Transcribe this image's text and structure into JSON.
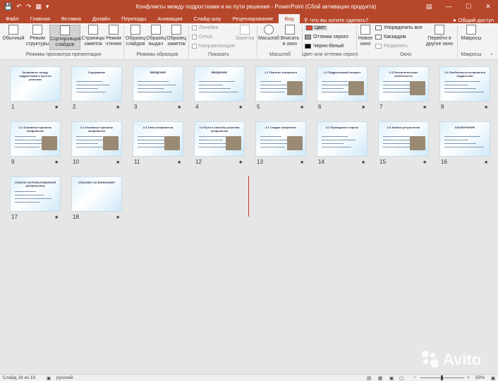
{
  "window": {
    "title": "Конфликты между подростками и их пути решения - PowerPoint (Сбой активации продукта)",
    "controls": [
      "—",
      "☐",
      "✕"
    ],
    "ribbon_display_icon": "ribbon-display-options-icon"
  },
  "quick_access": {
    "save_icon": "save-icon",
    "undo_icon": "undo-icon",
    "redo_icon": "redo-icon",
    "present_icon": "start-presentation-icon",
    "customize_icon": "customize-quick-access-icon"
  },
  "tabs": [
    "Файл",
    "Главная",
    "Вставка",
    "Дизайн",
    "Переходы",
    "Анимация",
    "Слайд-шоу",
    "Рецензирование",
    "Вид"
  ],
  "active_tab": "Вид",
  "tell_me": "Что вы хотите сделать?",
  "share": "Общий доступ",
  "ribbon": {
    "views": {
      "buttons": [
        {
          "label": "Обычный",
          "icon": "normal-view-icon"
        },
        {
          "label": "Режим структуры",
          "icon": "outline-view-icon"
        },
        {
          "label": "Сортировщик слайдов",
          "icon": "slide-sorter-icon",
          "selected": true
        },
        {
          "label": "Страницы заметок",
          "icon": "notes-page-icon"
        },
        {
          "label": "Режим чтения",
          "icon": "reading-view-icon"
        }
      ],
      "group": "Режимы просмотра презентации"
    },
    "masters": {
      "buttons": [
        {
          "label": "Образец слайдов",
          "icon": "slide-master-icon"
        },
        {
          "label": "Образец выдач",
          "icon": "handout-master-icon"
        },
        {
          "label": "Образец заметок",
          "icon": "notes-master-icon"
        }
      ],
      "group": "Режимы образцов"
    },
    "show": {
      "checks": [
        "Линейка",
        "Сетка",
        "Направляющие"
      ],
      "notes": "Заметки",
      "group": "Показать"
    },
    "zoom": {
      "buttons": [
        {
          "label": "Масштаб",
          "icon": "zoom-icon"
        },
        {
          "label": "Вписать в окно",
          "icon": "fit-to-window-icon"
        }
      ],
      "group": "Масштаб"
    },
    "color": {
      "options": [
        {
          "label": "Цвет",
          "swatch": "#e8412c"
        },
        {
          "label": "Оттенки серого",
          "swatch": "#9a9a9a"
        },
        {
          "label": "Черно-белый",
          "swatch": "#000000"
        }
      ],
      "group": "Цвет или оттенки серого"
    },
    "window": {
      "new_window": "Новое окно",
      "arrange_all": "Упорядочить все",
      "cascade": "Каскадом",
      "split": "Разделить",
      "switch": "Перейти в другое окно",
      "group": "Окно"
    },
    "macros": {
      "label": "Макросы",
      "group": "Макросы"
    }
  },
  "slides": [
    {
      "n": "1",
      "title": "Конфликты между подростками и пути их решения"
    },
    {
      "n": "2",
      "title": "Содержание"
    },
    {
      "n": "3",
      "title": "ВВЕДЕНИЕ"
    },
    {
      "n": "4",
      "title": "ВВЕДЕНИЕ"
    },
    {
      "n": "5",
      "title": "1.1 Понятие конфликта"
    },
    {
      "n": "6",
      "title": "1.2 Подростковый возраст"
    },
    {
      "n": "7",
      "title": "1.3 Психологические особенности"
    },
    {
      "n": "8",
      "title": "1.4 Особенности конфликтов подростков"
    },
    {
      "n": "9",
      "title": "2.1 Основные причины конфликтов"
    },
    {
      "n": "10",
      "title": "2.2 Основные причины конфликтов"
    },
    {
      "n": "11",
      "title": "2.3 Типы конфликтов"
    },
    {
      "n": "12",
      "title": "2.4 Пути и способы решения конфликтов"
    },
    {
      "n": "13",
      "title": "3.1 Стадии конфликта"
    },
    {
      "n": "14",
      "title": "3.2 Проведение опроса"
    },
    {
      "n": "15",
      "title": "3.3 Анализ результатов"
    },
    {
      "n": "16",
      "title": "ЗАКЛЮЧЕНИЕ"
    },
    {
      "n": "17",
      "title": "СПИСОК ИСПОЛЬЗОВАННОЙ ЛИТЕРАТУРЫ"
    },
    {
      "n": "18",
      "title": "СПАСИБО ЗА ВНИМАНИЕ!"
    }
  ],
  "transition_marker": "★",
  "status": {
    "slide_info": "Слайд 18 из 18",
    "language": "русский",
    "zoom": "50%",
    "zoom_out": "−",
    "zoom_in": "+"
  },
  "watermark": "Avito"
}
